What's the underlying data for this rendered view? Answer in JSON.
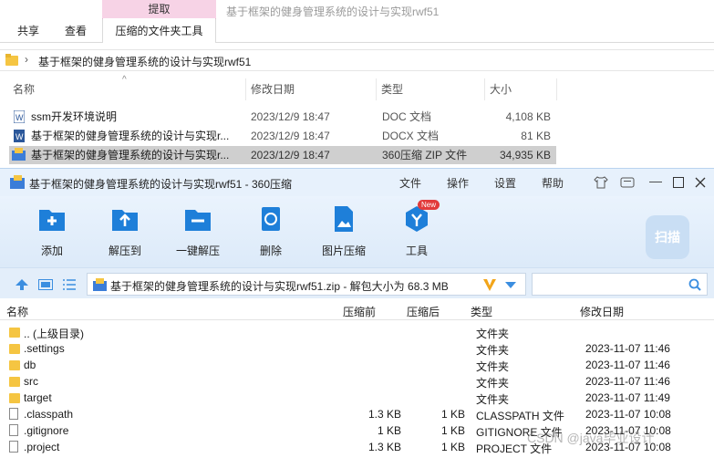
{
  "explorer": {
    "context_tab": "提取",
    "window_title": "基于框架的健身管理系统的设计与实现rwf51",
    "ribbon_tabs": [
      "共享",
      "查看",
      "压缩的文件夹工具"
    ],
    "address": "基于框架的健身管理系统的设计与实现rwf51",
    "columns": [
      "名称",
      "修改日期",
      "类型",
      "大小"
    ],
    "files": [
      {
        "name": "ssm开发环境说明",
        "date": "2023/12/9 18:47",
        "type": "DOC 文档",
        "size": "4,108 KB"
      },
      {
        "name": "基于框架的健身管理系统的设计与实现r...",
        "date": "2023/12/9 18:47",
        "type": "DOCX 文档",
        "size": "81 KB"
      },
      {
        "name": "基于框架的健身管理系统的设计与实现r...",
        "date": "2023/12/9 18:47",
        "type": "360压缩 ZIP 文件",
        "size": "34,935 KB"
      }
    ]
  },
  "zip": {
    "title": "基于框架的健身管理系统的设计与实现rwf51 - 360压缩",
    "menu": [
      "文件",
      "操作",
      "设置",
      "帮助"
    ],
    "toolbar": [
      {
        "label": "添加",
        "icon": "add-icon"
      },
      {
        "label": "解压到",
        "icon": "extract-to-icon"
      },
      {
        "label": "一键解压",
        "icon": "one-click-extract-icon"
      },
      {
        "label": "删除",
        "icon": "delete-icon"
      },
      {
        "label": "图片压缩",
        "icon": "image-compress-icon"
      },
      {
        "label": "工具",
        "icon": "tools-icon"
      }
    ],
    "new_badge": "New",
    "scan_label": "扫描",
    "path": "基于框架的健身管理系统的设计与实现rwf51.zip - 解包大小为 68.3 MB",
    "columns": [
      "名称",
      "压缩前",
      "压缩后",
      "类型",
      "修改日期"
    ],
    "rows": [
      {
        "name": ".. (上级目录)",
        "before": "",
        "after": "",
        "type": "文件夹",
        "date": "",
        "kind": "folder"
      },
      {
        "name": ".settings",
        "before": "",
        "after": "",
        "type": "文件夹",
        "date": "2023-11-07 11:46",
        "kind": "folder"
      },
      {
        "name": "db",
        "before": "",
        "after": "",
        "type": "文件夹",
        "date": "2023-11-07 11:46",
        "kind": "folder"
      },
      {
        "name": "src",
        "before": "",
        "after": "",
        "type": "文件夹",
        "date": "2023-11-07 11:46",
        "kind": "folder"
      },
      {
        "name": "target",
        "before": "",
        "after": "",
        "type": "文件夹",
        "date": "2023-11-07 11:49",
        "kind": "folder"
      },
      {
        "name": ".classpath",
        "before": "1.3 KB",
        "after": "1 KB",
        "type": "CLASSPATH 文件",
        "date": "2023-11-07 10:08",
        "kind": "file"
      },
      {
        "name": ".gitignore",
        "before": "1 KB",
        "after": "1 KB",
        "type": "GITIGNORE 文件",
        "date": "2023-11-07 10:08",
        "kind": "file"
      },
      {
        "name": ".project",
        "before": "1.3 KB",
        "after": "1 KB",
        "type": "PROJECT 文件",
        "date": "2023-11-07 10:08",
        "kind": "file"
      }
    ]
  },
  "watermark": "CSDN @java毕业设计"
}
